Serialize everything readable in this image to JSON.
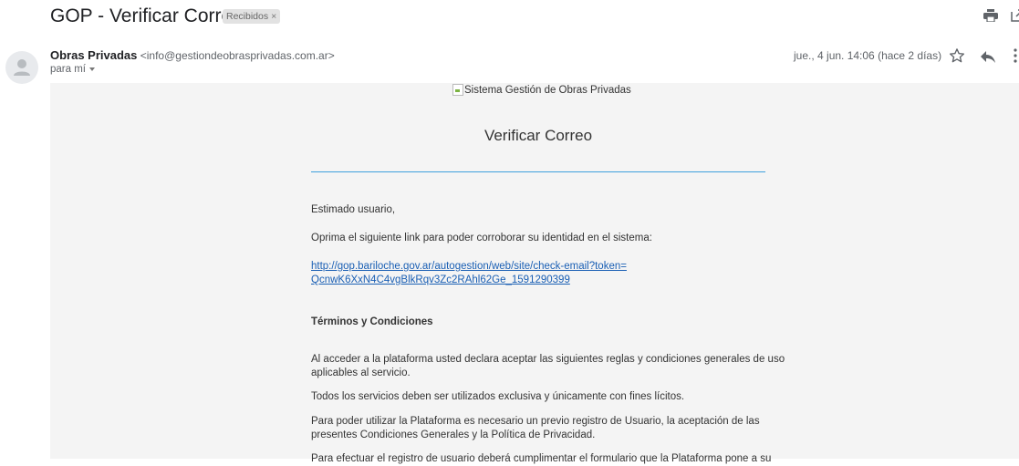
{
  "subject": "GOP - Verificar Correo",
  "label": {
    "text": "Recibidos",
    "close": "×"
  },
  "sender": {
    "name": "Obras Privadas",
    "email": "<info@gestiondeobrasprivadas.com.ar>",
    "to": "para mí"
  },
  "date": "jue., 4 jun. 14:06 (hace 2 días)",
  "icons": [
    "print-icon",
    "popout-icon",
    "star-icon",
    "reply-icon",
    "more-vert-icon",
    "avatar-icon"
  ],
  "email": {
    "logo_alt": "Sistema Gestión de Obras Privadas",
    "title": "Verificar Correo",
    "greeting": "Estimado usuario,",
    "instruction": "Oprima el siguiente link para poder corroborar su identidad en el sistema:",
    "link_line1": "http://gop.bariloche.gov.ar/autogestion/web/site/check-email?token=",
    "link_line2": "QcnwK6XxN4C4vgBlkRqv3Zc2RAhl62Ge_1591290399",
    "terms_heading": "Términos y Condiciones",
    "terms_p1_line1": "Al acceder a la plataforma usted declara aceptar las siguientes reglas y condiciones generales de uso",
    "terms_p1_line2": "aplicables al servicio.",
    "terms_p2": "Todos los servicios deben ser utilizados exclusiva y únicamente con fines lícitos.",
    "terms_p3_line1": "Para poder utilizar la Plataforma es necesario un previo registro de Usuario, la aceptación de las",
    "terms_p3_line2": "presentes Condiciones Generales y la Política de Privacidad.",
    "terms_p4": "Para efectuar el registro de usuario deberá cumplimentar el formulario que la Plataforma pone a su"
  }
}
